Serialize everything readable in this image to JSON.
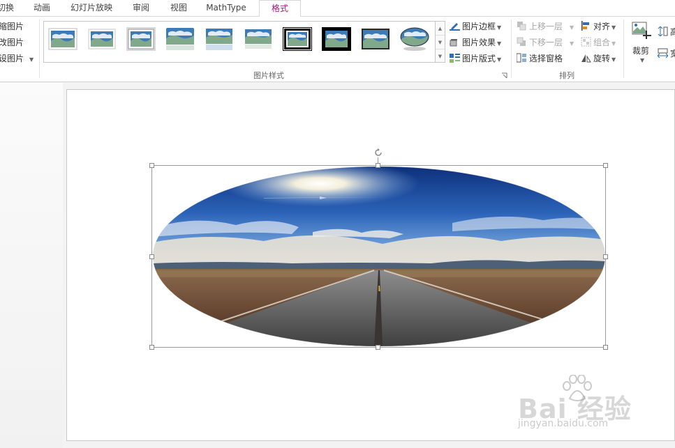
{
  "tabs": [
    {
      "label": "切换",
      "visible_text": "切换"
    },
    {
      "label": "动画"
    },
    {
      "label": "幻灯片放映"
    },
    {
      "label": "审阅"
    },
    {
      "label": "视图"
    },
    {
      "label": "MathType"
    },
    {
      "label": "格式",
      "active": true
    }
  ],
  "left_group": {
    "items": [
      "缩图片",
      "改图片",
      "设图片"
    ]
  },
  "picture_styles": {
    "group_label": "图片样式",
    "thumbs": [
      "simple-frame-white",
      "soft-edge-rect",
      "drop-shadow-rect-gray",
      "reflected-rounded-rect",
      "reflected-soft-edge",
      "reflected-bevel",
      "double-frame-black",
      "thick-black-frame",
      "simple-frame-black",
      "oval-reflected"
    ],
    "border_label": "图片边框",
    "effects_label": "图片效果",
    "layout_label": "图片版式"
  },
  "arrange": {
    "group_label": "排列",
    "bring_forward": "上移一层",
    "send_backward": "下移一层",
    "selection_pane": "选择窗格",
    "align": "对齐",
    "group": "组合",
    "rotate": "旋转"
  },
  "size": {
    "crop_label": "裁剪",
    "height_partial": "高",
    "width_partial": "宽"
  },
  "watermark": {
    "brand": "Bai 经验",
    "url": "jingyan.baidu.com"
  },
  "colors": {
    "accent_tab": "#a31a7e",
    "sky_top": "#1e4a9a",
    "ground": "#6b4a34"
  }
}
